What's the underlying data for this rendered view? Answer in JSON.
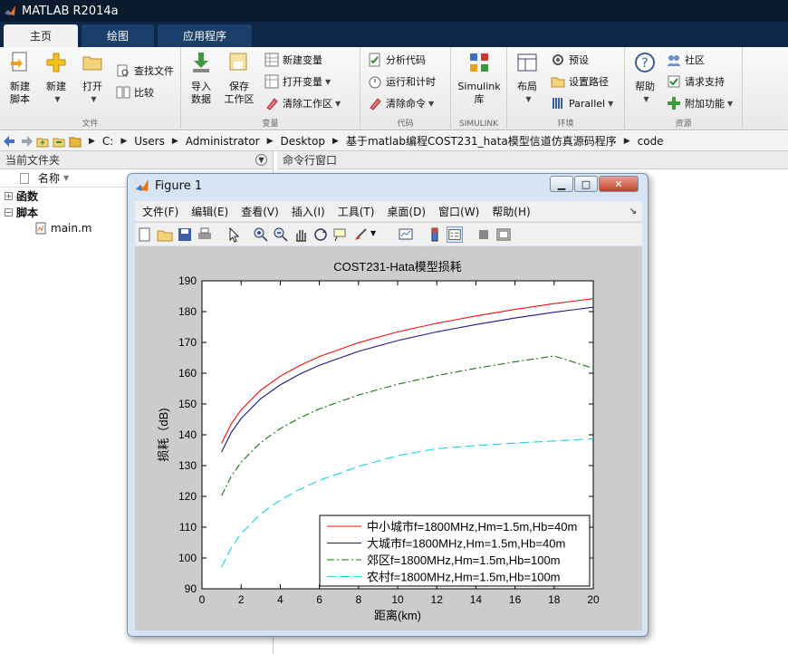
{
  "app": {
    "title": "MATLAB R2014a"
  },
  "tabs": [
    {
      "label": "主页",
      "active": true
    },
    {
      "label": "绘图",
      "active": false
    },
    {
      "label": "应用程序",
      "active": false
    }
  ],
  "ribbon": {
    "file": {
      "label": "文件",
      "new_script": "新建\n脚本",
      "new": "新建",
      "open": "打开",
      "find_files": "查找文件",
      "compare": "比较"
    },
    "variable": {
      "label": "变量",
      "import": "导入\n数据",
      "save_ws": "保存\n工作区",
      "new_var": "新建变量",
      "open_var": "打开变量",
      "clear_ws": "清除工作区"
    },
    "code": {
      "label": "代码",
      "analyze": "分析代码",
      "run_time": "运行和计时",
      "clear_cmd": "清除命令"
    },
    "simulink": {
      "label": "SIMULINK",
      "lib": "Simulink\n库"
    },
    "env": {
      "label": "环境",
      "layout": "布局",
      "prefs": "预设",
      "set_path": "设置路径",
      "parallel": "Parallel"
    },
    "resources": {
      "label": "资源",
      "help": "帮助",
      "community": "社区",
      "support": "请求支持",
      "addons": "附加功能"
    }
  },
  "address": {
    "crumbs": [
      "C:",
      "Users",
      "Administrator",
      "Desktop",
      "基于matlab编程COST231_hata模型信道仿真源码程序",
      "code"
    ]
  },
  "left_panel": {
    "title": "当前文件夹",
    "col_name": "名称",
    "tree": [
      {
        "label": "函数",
        "type": "group",
        "sign": "+"
      },
      {
        "label": "脚本",
        "type": "group",
        "sign": "−"
      },
      {
        "label": "main.m",
        "type": "file"
      }
    ]
  },
  "cmd_panel": {
    "title": "命令行窗口"
  },
  "figure": {
    "title": "Figure 1",
    "menu": [
      "文件(F)",
      "编辑(E)",
      "查看(V)",
      "插入(I)",
      "工具(T)",
      "桌面(D)",
      "窗口(W)",
      "帮助(H)"
    ]
  },
  "chart_data": {
    "type": "line",
    "title": "COST231-Hata模型损耗",
    "xlabel": "距离(km)",
    "ylabel": "损耗（dB)",
    "xlim": [
      0,
      20
    ],
    "ylim": [
      90,
      190
    ],
    "xticks": [
      "0",
      "2",
      "4",
      "6",
      "8",
      "10",
      "12",
      "14",
      "16",
      "18",
      "20"
    ],
    "yticks": [
      "90",
      "100",
      "110",
      "120",
      "130",
      "140",
      "150",
      "160",
      "170",
      "180",
      "190"
    ],
    "legend_position": "bottom-right",
    "series": [
      {
        "name": "中小城市f=1800MHz,Hm=1.5m,Hb=40m",
        "color": "#ee1111",
        "dash": "solid",
        "x": [
          1,
          1.5,
          2,
          3,
          4,
          5,
          6,
          8,
          10,
          12,
          14,
          16,
          18,
          20
        ],
        "y": [
          137.2,
          143.6,
          148.1,
          154.5,
          159.0,
          162.5,
          165.4,
          169.9,
          173.4,
          176.2,
          178.6,
          180.7,
          182.6,
          184.2
        ]
      },
      {
        "name": "大城市f=1800MHz,Hm=1.5m,Hb=40m",
        "color": "#1a1a88",
        "dash": "solid",
        "x": [
          1,
          1.5,
          2,
          3,
          4,
          5,
          6,
          8,
          10,
          12,
          14,
          16,
          18,
          20
        ],
        "y": [
          134.4,
          140.8,
          145.3,
          151.7,
          156.2,
          159.7,
          162.6,
          167.1,
          170.6,
          173.4,
          175.8,
          177.9,
          179.8,
          181.4
        ]
      },
      {
        "name": "郊区f=1800MHz,Hm=1.5m,Hb=100m",
        "color": "#117711",
        "dash": "dashdot",
        "x": [
          1,
          1.5,
          2,
          3,
          4,
          5,
          6,
          8,
          10,
          12,
          14,
          16,
          18,
          20
        ],
        "y": [
          120.2,
          126.6,
          131.1,
          137.5,
          142.0,
          145.5,
          148.4,
          152.9,
          156.4,
          159.2,
          161.6,
          163.7,
          165.6,
          161.6
        ]
      },
      {
        "name": "农村f=1800MHz,Hm=1.5m,Hb=100m",
        "color": "#11d8e6",
        "dash": "dashed",
        "x": [
          1,
          1.5,
          2,
          3,
          4,
          5,
          6,
          8,
          10,
          12,
          14,
          16,
          18,
          20
        ],
        "y": [
          97.0,
          103.4,
          107.9,
          114.3,
          118.8,
          122.3,
          125.2,
          129.7,
          133.2,
          135.5,
          136.5,
          137.3,
          138.0,
          138.7
        ]
      }
    ]
  }
}
